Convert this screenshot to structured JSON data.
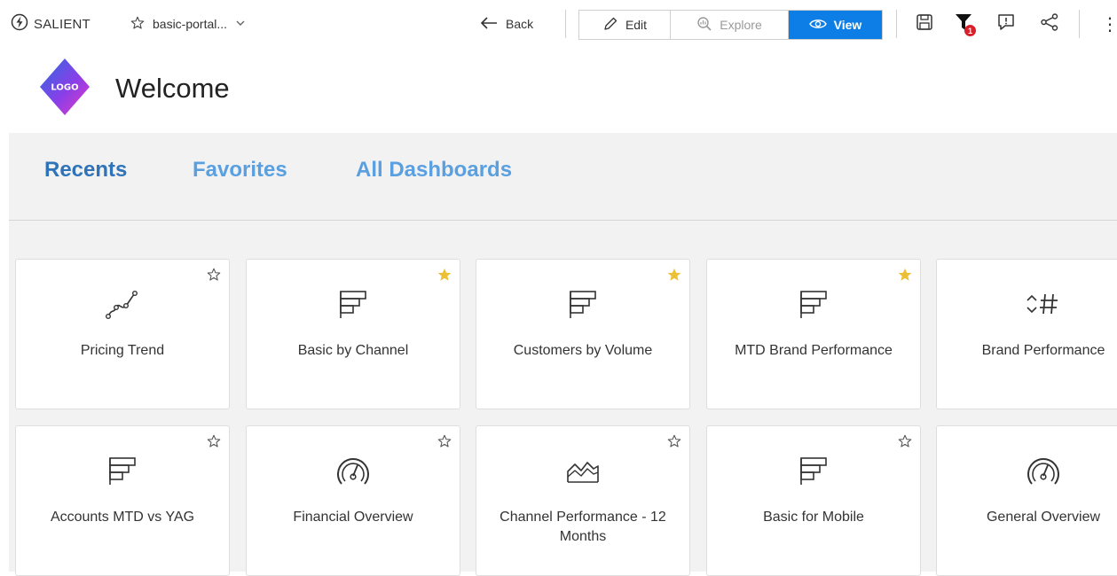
{
  "toolbar": {
    "brand": "SALIENT",
    "breadcrumb": "basic-portal...",
    "back_label": "Back",
    "edit_label": "Edit",
    "explore_label": "Explore",
    "view_label": "View",
    "filter_badge": "1",
    "accent_color": "#0d7ee6"
  },
  "header": {
    "logo_text": "LOGO",
    "title": "Welcome"
  },
  "tabs": [
    {
      "label": "Recents",
      "active": true
    },
    {
      "label": "Favorites",
      "active": false
    },
    {
      "label": "All Dashboards",
      "active": false
    }
  ],
  "cards": [
    {
      "title": "Pricing Trend",
      "icon": "scatter-chart-icon",
      "favorite": false
    },
    {
      "title": "Basic by Channel",
      "icon": "bar-chart-icon",
      "favorite": true
    },
    {
      "title": "Customers by Volume",
      "icon": "bar-chart-icon",
      "favorite": true
    },
    {
      "title": "MTD Brand Performance",
      "icon": "bar-chart-icon",
      "favorite": true
    },
    {
      "title": "Brand Performance",
      "icon": "kpi-number-icon",
      "favorite": false
    },
    {
      "title": "Accounts MTD vs YAG",
      "icon": "bar-chart-icon",
      "favorite": false
    },
    {
      "title": "Financial Overview",
      "icon": "gauge-icon",
      "favorite": false
    },
    {
      "title": "Channel Performance - 12 Months",
      "icon": "area-chart-icon",
      "favorite": false
    },
    {
      "title": "Basic for Mobile",
      "icon": "bar-chart-icon",
      "favorite": false
    },
    {
      "title": "General Overview",
      "icon": "gauge-icon",
      "favorite": false
    }
  ]
}
